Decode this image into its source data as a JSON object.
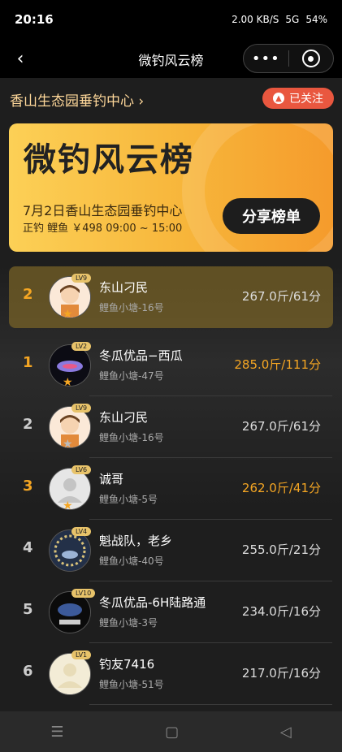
{
  "status": {
    "time": "20:16",
    "speed": "2.00 KB/S",
    "battery": "54%",
    "net": "5G"
  },
  "nav": {
    "title": "微钓风云榜",
    "more_icon": "•••"
  },
  "venue": {
    "name": "香山生态园垂钓中心 ›",
    "follow_label": "已关注"
  },
  "banner": {
    "title": "微钓风云榜",
    "event": "7月2日香山生态园垂钓中心",
    "meta": "正钓  鲤鱼  ￥498  09:00 ~ 15:00",
    "share_label": "分享榜单"
  },
  "my_row": {
    "rank": "2",
    "lv": "LV9",
    "name": "东山刁民",
    "pond": "鲤鱼小塘-16号",
    "score": "267.0斤/61分"
  },
  "rows": [
    {
      "rank": "1",
      "lv": "LV2",
      "name": "冬瓜优品−西瓜",
      "pond": "鲤鱼小塘-47号",
      "score": "285.0斤/111分",
      "highlight": true
    },
    {
      "rank": "2",
      "lv": "LV9",
      "name": "东山刁民",
      "pond": "鲤鱼小塘-16号",
      "score": "267.0斤/61分",
      "highlight": false
    },
    {
      "rank": "3",
      "lv": "LV6",
      "name": "诚哥",
      "pond": "鲤鱼小塘-5号",
      "score": "262.0斤/41分",
      "highlight": true
    },
    {
      "rank": "4",
      "lv": "LV4",
      "name": "魁战队，老乡",
      "pond": "鲤鱼小塘-40号",
      "score": "255.0斤/21分",
      "highlight": false
    },
    {
      "rank": "5",
      "lv": "LV10",
      "name": "冬瓜优品-6H陆路通",
      "pond": "鲤鱼小塘-3号",
      "score": "234.0斤/16分",
      "highlight": false
    },
    {
      "rank": "6",
      "lv": "LV1",
      "name": "钓友7416",
      "pond": "鲤鱼小塘-51号",
      "score": "217.0斤/16分",
      "highlight": false
    }
  ],
  "bottom": {
    "menu_icon": "☰",
    "home_icon": "▢",
    "back_icon": "◁"
  }
}
